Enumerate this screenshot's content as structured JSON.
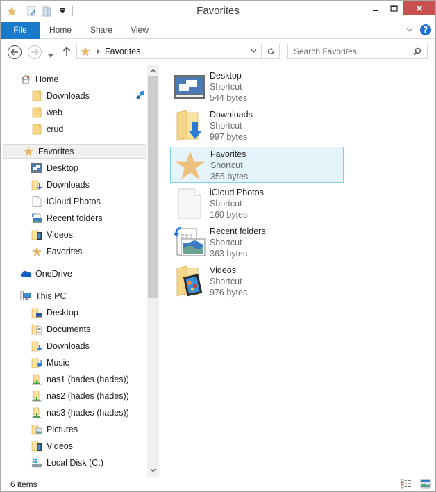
{
  "window": {
    "title": "Favorites"
  },
  "ribbon": {
    "tabs": [
      {
        "label": "File",
        "active": true
      },
      {
        "label": "Home"
      },
      {
        "label": "Share"
      },
      {
        "label": "View"
      }
    ]
  },
  "navigation": {
    "address_path": [
      "Favorites"
    ],
    "search_placeholder": "Search Favorites"
  },
  "nav_pane": {
    "items": [
      {
        "label": "Home",
        "icon": "home-icon",
        "level": 0
      },
      {
        "label": "Downloads",
        "icon": "folder-icon",
        "level": 1,
        "pinned": true
      },
      {
        "label": "web",
        "icon": "folder-icon",
        "level": 1
      },
      {
        "label": "crud",
        "icon": "folder-icon",
        "level": 1
      },
      {
        "label": "Favorites",
        "icon": "star-icon",
        "level": 0,
        "selected": true
      },
      {
        "label": "Desktop",
        "icon": "desktop-icon",
        "level": 1
      },
      {
        "label": "Downloads",
        "icon": "downloads-folder-icon",
        "level": 1
      },
      {
        "label": "iCloud Photos",
        "icon": "file-icon",
        "level": 1
      },
      {
        "label": "Recent folders",
        "icon": "recent-folders-icon",
        "level": 1
      },
      {
        "label": "Videos",
        "icon": "videos-folder-icon",
        "level": 1
      },
      {
        "label": "Favorites",
        "icon": "star-icon",
        "level": 1
      },
      {
        "label": "OneDrive",
        "icon": "onedrive-cloud-icon",
        "level": 0
      },
      {
        "label": "This PC",
        "icon": "this-pc-icon",
        "level": 0
      },
      {
        "label": "Desktop",
        "icon": "desktop-folder-icon",
        "level": 1
      },
      {
        "label": "Documents",
        "icon": "documents-folder-icon",
        "level": 1
      },
      {
        "label": "Downloads",
        "icon": "downloads-folder-icon",
        "level": 1
      },
      {
        "label": "Music",
        "icon": "music-folder-icon",
        "level": 1
      },
      {
        "label": "nas1 (hades (hades))",
        "icon": "network-drive-icon",
        "level": 1
      },
      {
        "label": "nas2 (hades (hades))",
        "icon": "network-drive-icon",
        "level": 1
      },
      {
        "label": "nas3 (hades (hades))",
        "icon": "network-drive-icon",
        "level": 1
      },
      {
        "label": "Pictures",
        "icon": "pictures-folder-icon",
        "level": 1
      },
      {
        "label": "Videos",
        "icon": "videos-folder-icon",
        "level": 1
      },
      {
        "label": "Local Disk (C:)",
        "icon": "local-disk-icon",
        "level": 1
      }
    ]
  },
  "content": {
    "files": [
      {
        "name": "Desktop",
        "type": "Shortcut",
        "size": "544 bytes",
        "icon": "desktop-icon"
      },
      {
        "name": "Downloads",
        "type": "Shortcut",
        "size": "997 bytes",
        "icon": "downloads-folder-icon"
      },
      {
        "name": "Favorites",
        "type": "Shortcut",
        "size": "355 bytes",
        "icon": "star-icon",
        "selected": true
      },
      {
        "name": "iCloud Photos",
        "type": "Shortcut",
        "size": "160 bytes",
        "icon": "file-icon"
      },
      {
        "name": "Recent folders",
        "type": "Shortcut",
        "size": "363 bytes",
        "icon": "recent-folders-icon"
      },
      {
        "name": "Videos",
        "type": "Shortcut",
        "size": "976 bytes",
        "icon": "videos-folder-icon"
      }
    ]
  },
  "status": {
    "item_count": "6 items"
  },
  "colors": {
    "accent": "#1979ca",
    "close_button": "#c75050",
    "selection_bg": "#e5f3fb",
    "selection_border": "#7dcff5",
    "star": "#e8b86d"
  }
}
